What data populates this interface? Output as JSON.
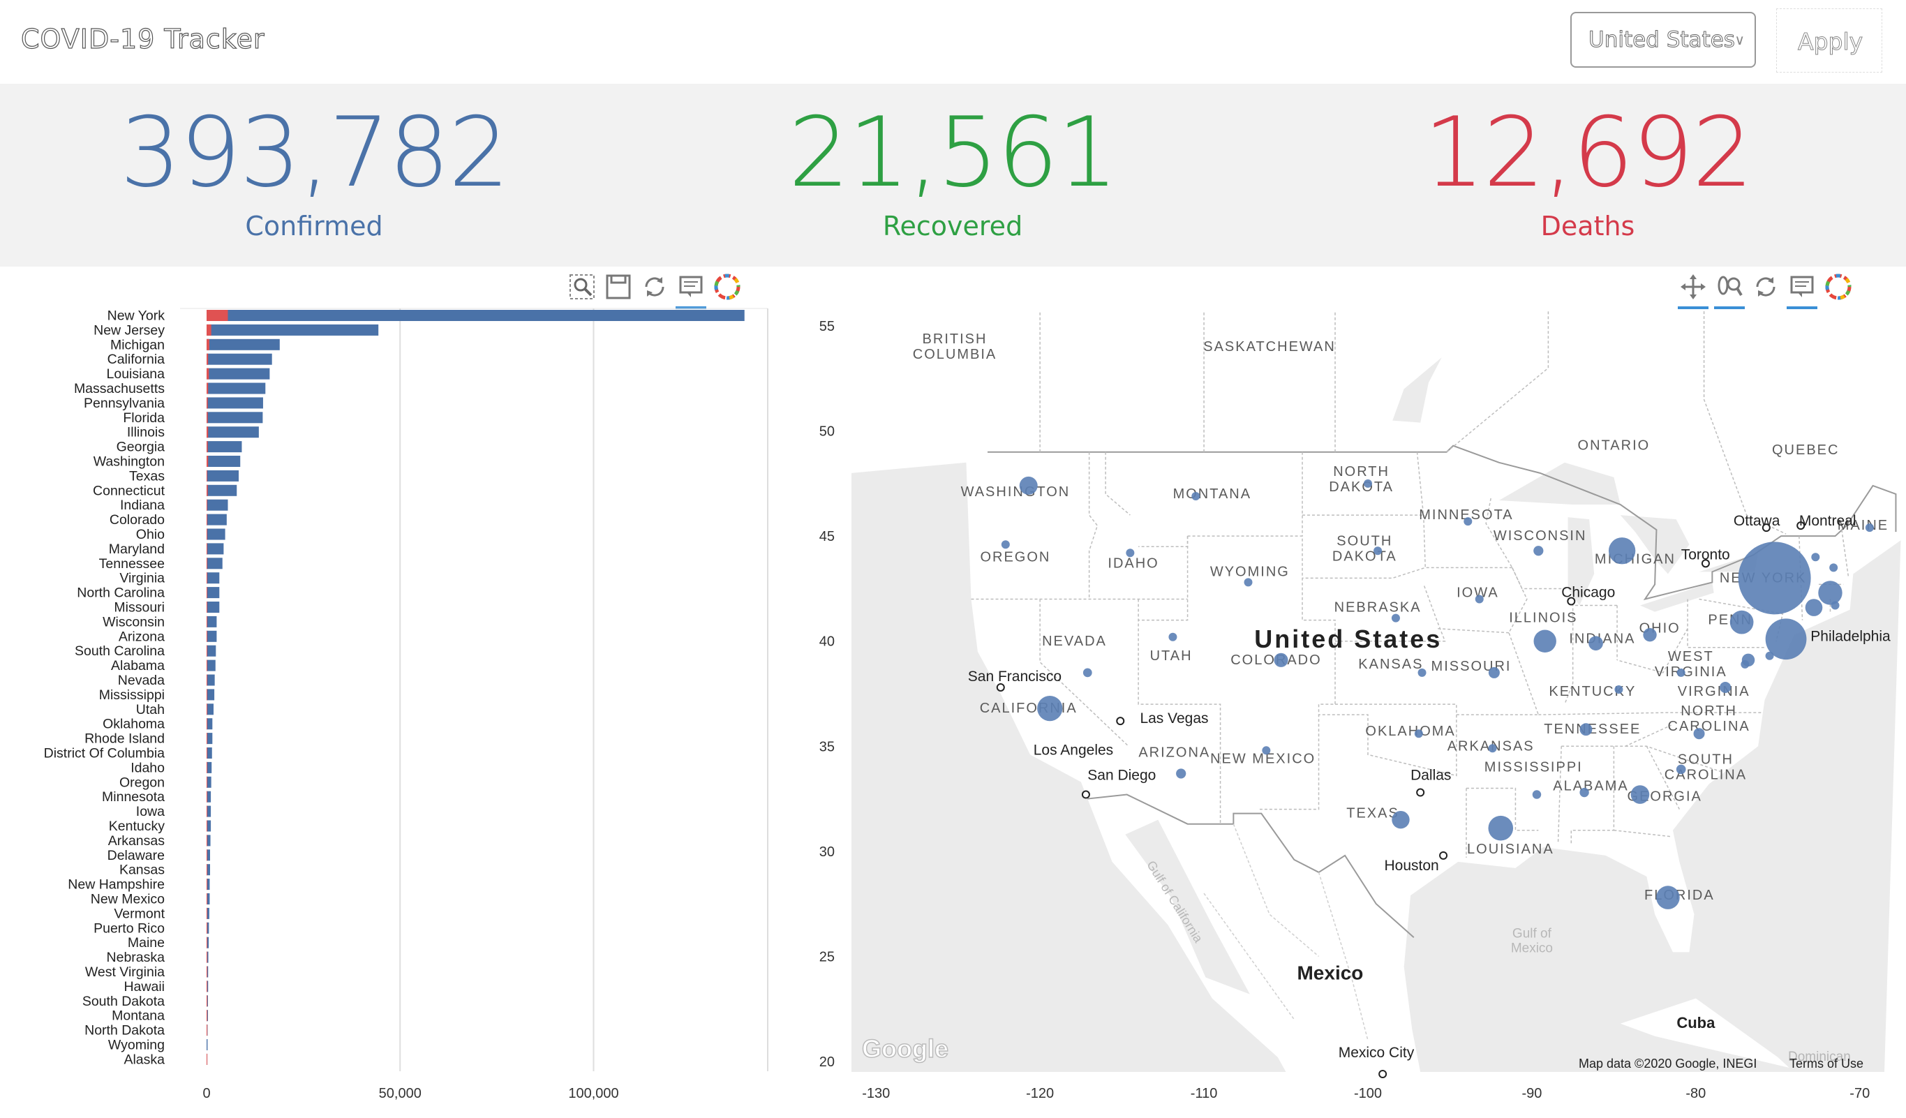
{
  "app": {
    "title": "COVID-19 Tracker"
  },
  "controls": {
    "country": "United States",
    "apply_label": "Apply"
  },
  "stats": {
    "confirmed": {
      "value": "393,782",
      "label": "Confirmed",
      "color": "#4a72a8"
    },
    "recovered": {
      "value": "21,561",
      "label": "Recovered",
      "color": "#2ea043"
    },
    "deaths": {
      "value": "12,692",
      "label": "Deaths",
      "color": "#d43a4a"
    }
  },
  "left_toolbar": [
    "box-zoom-icon",
    "save-icon",
    "reset-icon",
    "hover-icon",
    "bokeh-logo-icon"
  ],
  "right_toolbar": [
    "pan-icon",
    "wheel-zoom-icon",
    "reset-icon",
    "hover-icon",
    "bokeh-logo-icon"
  ],
  "chart_data": [
    {
      "type": "bar",
      "orientation": "horizontal",
      "categories": [
        "New York",
        "New Jersey",
        "Michigan",
        "California",
        "Louisiana",
        "Massachusetts",
        "Pennsylvania",
        "Florida",
        "Illinois",
        "Georgia",
        "Washington",
        "Texas",
        "Connecticut",
        "Indiana",
        "Colorado",
        "Ohio",
        "Maryland",
        "Tennessee",
        "Virginia",
        "North Carolina",
        "Missouri",
        "Wisconsin",
        "Arizona",
        "South Carolina",
        "Alabama",
        "Nevada",
        "Mississippi",
        "Utah",
        "Oklahoma",
        "Rhode Island",
        "District Of Columbia",
        "Idaho",
        "Oregon",
        "Minnesota",
        "Iowa",
        "Kentucky",
        "Arkansas",
        "Delaware",
        "Kansas",
        "New Hampshire",
        "New Mexico",
        "Vermont",
        "Puerto Rico",
        "Maine",
        "Nebraska",
        "West Virginia",
        "Hawaii",
        "South Dakota",
        "Montana",
        "North Dakota",
        "Wyoming",
        "Alaska"
      ],
      "series": [
        {
          "color": "#4a72a8",
          "values": [
            139000,
            44400,
            18900,
            16900,
            16300,
            15200,
            14600,
            14500,
            13500,
            9100,
            8700,
            8300,
            7800,
            5500,
            5200,
            4800,
            4400,
            4100,
            3300,
            3300,
            3300,
            2600,
            2600,
            2400,
            2300,
            2100,
            2000,
            1800,
            1500,
            1500,
            1400,
            1300,
            1200,
            1100,
            1100,
            1100,
            1000,
            900,
            900,
            800,
            800,
            700,
            600,
            550,
            450,
            400,
            400,
            350,
            350,
            250,
            250,
            200
          ]
        },
        {
          "color": "#e05252",
          "values": [
            5500,
            1200,
            700,
            400,
            600,
            400,
            300,
            300,
            400,
            300,
            400,
            150,
            300,
            150,
            100,
            150,
            100,
            60,
            60,
            60,
            60,
            60,
            60,
            60,
            60,
            60,
            60,
            20,
            60,
            40,
            30,
            20,
            40,
            40,
            25,
            60,
            20,
            20,
            30,
            20,
            20,
            25,
            30,
            10,
            10,
            10,
            5,
            5,
            5,
            5,
            0,
            5
          ]
        }
      ],
      "xticks": [
        "0",
        "50,000",
        "100,000"
      ],
      "xlim": [
        0,
        145000
      ]
    },
    {
      "type": "scatter",
      "title": "United States",
      "xticks": [
        "-130",
        "-120",
        "-110",
        "-100",
        "-90",
        "-80",
        "-70"
      ],
      "yticks": [
        "55",
        "50",
        "45",
        "40",
        "35",
        "30",
        "25",
        "20"
      ],
      "xlim": [
        -131.5,
        -68.5
      ],
      "ylim": [
        19.5,
        55.7
      ],
      "points": [
        {
          "lon": -75.2,
          "lat": 43.0,
          "v": 139000
        },
        {
          "lon": -74.5,
          "lat": 40.1,
          "v": 44400
        },
        {
          "lon": -84.5,
          "lat": 44.3,
          "v": 18900
        },
        {
          "lon": -119.4,
          "lat": 36.8,
          "v": 16900
        },
        {
          "lon": -91.9,
          "lat": 31.1,
          "v": 16300
        },
        {
          "lon": -71.8,
          "lat": 42.3,
          "v": 15200
        },
        {
          "lon": -77.2,
          "lat": 40.9,
          "v": 14600
        },
        {
          "lon": -81.7,
          "lat": 27.8,
          "v": 14500
        },
        {
          "lon": -89.2,
          "lat": 40.0,
          "v": 13500
        },
        {
          "lon": -83.4,
          "lat": 32.7,
          "v": 9100
        },
        {
          "lon": -120.7,
          "lat": 47.4,
          "v": 8700
        },
        {
          "lon": -98.0,
          "lat": 31.5,
          "v": 8300
        },
        {
          "lon": -72.8,
          "lat": 41.6,
          "v": 7800
        },
        {
          "lon": -86.1,
          "lat": 39.9,
          "v": 5500
        },
        {
          "lon": -105.3,
          "lat": 39.1,
          "v": 5200
        },
        {
          "lon": -82.8,
          "lat": 40.3,
          "v": 4800
        },
        {
          "lon": -76.8,
          "lat": 39.1,
          "v": 4400
        },
        {
          "lon": -86.7,
          "lat": 35.8,
          "v": 4100
        },
        {
          "lon": -78.2,
          "lat": 37.8,
          "v": 3300
        },
        {
          "lon": -79.8,
          "lat": 35.6,
          "v": 3300
        },
        {
          "lon": -92.3,
          "lat": 38.5,
          "v": 3300
        },
        {
          "lon": -89.6,
          "lat": 44.3,
          "v": 2600
        },
        {
          "lon": -111.4,
          "lat": 33.7,
          "v": 2600
        },
        {
          "lon": -80.9,
          "lat": 33.9,
          "v": 2400
        },
        {
          "lon": -86.8,
          "lat": 32.8,
          "v": 2300
        },
        {
          "lon": -117.1,
          "lat": 38.5,
          "v": 2100
        },
        {
          "lon": -89.7,
          "lat": 32.7,
          "v": 2000
        },
        {
          "lon": -111.9,
          "lat": 40.2,
          "v": 1800
        },
        {
          "lon": -96.9,
          "lat": 35.6,
          "v": 1500
        },
        {
          "lon": -71.5,
          "lat": 41.7,
          "v": 1500
        },
        {
          "lon": -77.0,
          "lat": 38.9,
          "v": 1400
        },
        {
          "lon": -114.5,
          "lat": 44.2,
          "v": 1300
        },
        {
          "lon": -122.1,
          "lat": 44.6,
          "v": 1200
        },
        {
          "lon": -93.9,
          "lat": 45.7,
          "v": 1100
        },
        {
          "lon": -93.2,
          "lat": 42.0,
          "v": 1100
        },
        {
          "lon": -84.7,
          "lat": 37.7,
          "v": 1100
        },
        {
          "lon": -92.4,
          "lat": 34.9,
          "v": 1000
        },
        {
          "lon": -75.5,
          "lat": 39.3,
          "v": 900
        },
        {
          "lon": -96.7,
          "lat": 38.5,
          "v": 900
        },
        {
          "lon": -71.6,
          "lat": 43.5,
          "v": 800
        },
        {
          "lon": -106.2,
          "lat": 34.8,
          "v": 800
        },
        {
          "lon": -72.7,
          "lat": 44.0,
          "v": 700
        },
        {
          "lon": -69.4,
          "lat": 45.4,
          "v": 550
        },
        {
          "lon": -98.3,
          "lat": 41.1,
          "v": 450
        },
        {
          "lon": -80.9,
          "lat": 38.5,
          "v": 400
        },
        {
          "lon": -99.4,
          "lat": 44.3,
          "v": 350
        },
        {
          "lon": -110.5,
          "lat": 46.9,
          "v": 350
        },
        {
          "lon": -100.0,
          "lat": 47.5,
          "v": 250
        },
        {
          "lon": -107.3,
          "lat": 42.8,
          "v": 250
        }
      ]
    }
  ],
  "map": {
    "region_labels": [
      {
        "text": "BRITISH\nCOLUMBIA",
        "lon": -125.2,
        "lat": 53.8
      },
      {
        "text": "SASKATCHEWAN",
        "lon": -106.0,
        "lat": 53.8
      },
      {
        "text": "ONTARIO",
        "lon": -85.0,
        "lat": 49.1
      },
      {
        "text": "QUEBEC",
        "lon": -73.3,
        "lat": 48.9
      },
      {
        "text": "WASHINGTON",
        "lon": -121.5,
        "lat": 46.9
      },
      {
        "text": "MONTANA",
        "lon": -109.5,
        "lat": 46.8
      },
      {
        "text": "NORTH\nDAKOTA",
        "lon": -100.4,
        "lat": 47.5
      },
      {
        "text": "MINNESOTA",
        "lon": -94.0,
        "lat": 45.8
      },
      {
        "text": "OREGON",
        "lon": -121.5,
        "lat": 43.8
      },
      {
        "text": "IDAHO",
        "lon": -114.3,
        "lat": 43.5
      },
      {
        "text": "WYOMING",
        "lon": -107.2,
        "lat": 43.1
      },
      {
        "text": "SOUTH\nDAKOTA",
        "lon": -100.2,
        "lat": 44.2
      },
      {
        "text": "WISCONSIN",
        "lon": -89.5,
        "lat": 44.8
      },
      {
        "text": "MICHIGAN",
        "lon": -83.7,
        "lat": 43.7
      },
      {
        "text": "IOWA",
        "lon": -93.3,
        "lat": 42.1
      },
      {
        "text": "NEBRASKA",
        "lon": -99.4,
        "lat": 41.4
      },
      {
        "text": "ILLINOIS",
        "lon": -89.3,
        "lat": 40.9
      },
      {
        "text": "INDIANA",
        "lon": -85.7,
        "lat": 39.9
      },
      {
        "text": "OHIO",
        "lon": -82.2,
        "lat": 40.4
      },
      {
        "text": "PENN",
        "lon": -77.9,
        "lat": 40.8
      },
      {
        "text": "NEW YORK",
        "lon": -75.9,
        "lat": 42.8
      },
      {
        "text": "NEVADA",
        "lon": -117.9,
        "lat": 39.8
      },
      {
        "text": "UTAH",
        "lon": -112.0,
        "lat": 39.1
      },
      {
        "text": "COLORADO",
        "lon": -105.6,
        "lat": 38.9
      },
      {
        "text": "KANSAS",
        "lon": -98.6,
        "lat": 38.7
      },
      {
        "text": "MISSOURI",
        "lon": -93.7,
        "lat": 38.6
      },
      {
        "text": "WEST\nVIRGINIA",
        "lon": -80.3,
        "lat": 38.7
      },
      {
        "text": "KENTUCKY",
        "lon": -86.3,
        "lat": 37.4
      },
      {
        "text": "VIRGINIA",
        "lon": -78.9,
        "lat": 37.4
      },
      {
        "text": "CALIFORNIA",
        "lon": -120.7,
        "lat": 36.6
      },
      {
        "text": "OKLAHOMA",
        "lon": -97.4,
        "lat": 35.5
      },
      {
        "text": "TENNESSEE",
        "lon": -86.3,
        "lat": 35.6
      },
      {
        "text": "NORTH\nCAROLINA",
        "lon": -79.2,
        "lat": 36.1
      },
      {
        "text": "ARKANSAS",
        "lon": -92.5,
        "lat": 34.8
      },
      {
        "text": "ARIZONA",
        "lon": -111.8,
        "lat": 34.5
      },
      {
        "text": "NEW MEXICO",
        "lon": -106.4,
        "lat": 34.2
      },
      {
        "text": "MISSISSIPPI",
        "lon": -89.9,
        "lat": 33.8
      },
      {
        "text": "SOUTH\nCAROLINA",
        "lon": -79.4,
        "lat": 33.8
      },
      {
        "text": "ALABAMA",
        "lon": -86.4,
        "lat": 32.9
      },
      {
        "text": "GEORGIA",
        "lon": -81.9,
        "lat": 32.4
      },
      {
        "text": "TEXAS",
        "lon": -99.7,
        "lat": 31.6
      },
      {
        "text": "LOUISIANA",
        "lon": -91.3,
        "lat": 29.9
      },
      {
        "text": "FLORIDA",
        "lon": -81.0,
        "lat": 27.7
      },
      {
        "text": "MAINE",
        "lon": -69.8,
        "lat": 45.3
      }
    ],
    "country_label": {
      "text": "United States",
      "lon": -101.2,
      "lat": 39.7
    },
    "mexico_label": {
      "text": "Mexico",
      "lon": -102.3,
      "lat": 23.9
    },
    "cuba_label": {
      "text": "Cuba",
      "lon": -80.0,
      "lat": 21.6
    },
    "cities": [
      {
        "text": "Ottawa",
        "lon": -77.7,
        "lat": 45.5,
        "dot": true,
        "dlon": -75.7,
        "dlat": 45.4
      },
      {
        "text": "Montreal",
        "lon": -73.7,
        "lat": 45.5,
        "dot": true,
        "dlon": -73.6,
        "dlat": 45.5
      },
      {
        "text": "Toronto",
        "lon": -80.9,
        "lat": 43.9,
        "dot": true,
        "dlon": -79.4,
        "dlat": 43.7
      },
      {
        "text": "Chicago",
        "lon": -88.2,
        "lat": 42.1,
        "dot": true,
        "dlon": -87.6,
        "dlat": 41.9
      },
      {
        "text": "Philadelphia",
        "lon": -73.0,
        "lat": 40.0,
        "dot": false
      },
      {
        "text": "San Francisco",
        "lon": -124.4,
        "lat": 38.1,
        "dot": true,
        "dlon": -122.4,
        "dlat": 37.8
      },
      {
        "text": "Las Vegas",
        "lon": -113.9,
        "lat": 36.1,
        "dot": true,
        "dlon": -115.1,
        "dlat": 36.2
      },
      {
        "text": "Los Angeles",
        "lon": -120.4,
        "lat": 34.6,
        "dot": false
      },
      {
        "text": "San Diego",
        "lon": -117.1,
        "lat": 33.4,
        "dot": true,
        "dlon": -117.2,
        "dlat": 32.7
      },
      {
        "text": "Dallas",
        "lon": -97.4,
        "lat": 33.4,
        "dot": true,
        "dlon": -96.8,
        "dlat": 32.8
      },
      {
        "text": "Houston",
        "lon": -99.0,
        "lat": 29.1,
        "dot": true,
        "dlon": -95.4,
        "dlat": 29.8
      },
      {
        "text": "Mexico City",
        "lon": -101.8,
        "lat": 20.2,
        "dot": true,
        "dlon": -99.1,
        "dlat": 19.4
      }
    ],
    "water_labels": [
      {
        "text": "Gulf of\nMexico",
        "lon": -90.0,
        "lat": 25.5
      },
      {
        "text": "Gulf of California",
        "lon": -112.0,
        "lat": 27.5
      }
    ],
    "attribution": "Map data ©2020 Google, INEGI",
    "terms": "Terms of Use",
    "google": "Google",
    "dominican": "Dominican"
  }
}
